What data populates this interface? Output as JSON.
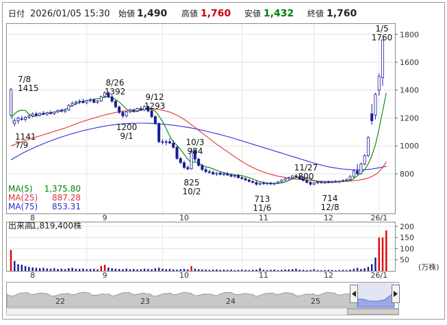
{
  "header": {
    "date_label": "日付",
    "datetime": "2026/01/05 15:30",
    "open_label": "始値",
    "open_value": "1,490",
    "high_label": "高値",
    "high_value": "1,760",
    "low_label": "安値",
    "low_value": "1,432",
    "close_label": "終値",
    "close_value": "1,760"
  },
  "legend": [
    {
      "name": "MA(5)",
      "value": "1,375.80",
      "color": "#008000"
    },
    {
      "name": "MA(25)",
      "value": "887.28",
      "color": "#e03030"
    },
    {
      "name": "MA(75)",
      "value": "853.31",
      "color": "#2b2bd8"
    }
  ],
  "volume_header": {
    "label": "出来高",
    "value": "1,819,400株"
  },
  "volume_unit": "(万株)",
  "colors": {
    "up": "#1a1a9a",
    "down": "#ffffff",
    "down_stroke": "#1a1a9a",
    "volume_bar": "#1a1a9a",
    "volume_highlight": "#e00000",
    "ma5": "#008000",
    "ma25": "#e03030",
    "ma75": "#2b2bd8",
    "high_value": "#cc0000",
    "low_value": "#008000"
  },
  "chart_data": {
    "type": "candlestick",
    "price_axis": {
      "ticks": [
        800,
        1000,
        1200,
        1400,
        1600,
        1800
      ],
      "range": [
        520,
        1870
      ]
    },
    "volume_axis": {
      "ticks": [
        50,
        100,
        150,
        200
      ],
      "range": [
        0,
        215
      ]
    },
    "x_tick_labels": [
      "8",
      "9",
      "10",
      "11",
      "12",
      "26/1"
    ],
    "navigator_labels": [
      "22",
      "23",
      "24",
      "25"
    ],
    "annotations": [
      {
        "date": "7/8",
        "value": "1415",
        "kind": "high"
      },
      {
        "date": "7/9",
        "value": "1141",
        "kind": "low"
      },
      {
        "date": "8/26",
        "value": "1392",
        "kind": "high"
      },
      {
        "date": "9/1",
        "value": "1200",
        "kind": "low"
      },
      {
        "date": "9/12",
        "value": "1293",
        "kind": "high"
      },
      {
        "date": "10/3",
        "value": "984",
        "kind": "high"
      },
      {
        "date": "10/2",
        "value": "825",
        "kind": "low"
      },
      {
        "date": "11/6",
        "value": "713",
        "kind": "low"
      },
      {
        "date": "11/27",
        "value": "800",
        "kind": "high"
      },
      {
        "date": "12/8",
        "value": "714",
        "kind": "low"
      },
      {
        "date": "1/5",
        "value": "1760",
        "kind": "high"
      }
    ],
    "candles": [
      {
        "o": 1220,
        "h": 1415,
        "l": 1210,
        "c": 1405
      },
      {
        "o": 1160,
        "h": 1200,
        "l": 1141,
        "c": 1180
      },
      {
        "o": 1180,
        "h": 1210,
        "l": 1160,
        "c": 1200
      },
      {
        "o": 1195,
        "h": 1215,
        "l": 1180,
        "c": 1190
      },
      {
        "o": 1190,
        "h": 1215,
        "l": 1175,
        "c": 1205
      },
      {
        "o": 1205,
        "h": 1225,
        "l": 1195,
        "c": 1215
      },
      {
        "o": 1215,
        "h": 1240,
        "l": 1205,
        "c": 1230
      },
      {
        "o": 1230,
        "h": 1245,
        "l": 1210,
        "c": 1220
      },
      {
        "o": 1220,
        "h": 1240,
        "l": 1210,
        "c": 1235
      },
      {
        "o": 1235,
        "h": 1250,
        "l": 1220,
        "c": 1228
      },
      {
        "o": 1228,
        "h": 1245,
        "l": 1215,
        "c": 1240
      },
      {
        "o": 1240,
        "h": 1255,
        "l": 1225,
        "c": 1232
      },
      {
        "o": 1232,
        "h": 1248,
        "l": 1222,
        "c": 1244
      },
      {
        "o": 1244,
        "h": 1262,
        "l": 1235,
        "c": 1255
      },
      {
        "o": 1255,
        "h": 1268,
        "l": 1240,
        "c": 1248
      },
      {
        "o": 1248,
        "h": 1262,
        "l": 1235,
        "c": 1258
      },
      {
        "o": 1258,
        "h": 1300,
        "l": 1250,
        "c": 1290
      },
      {
        "o": 1290,
        "h": 1320,
        "l": 1280,
        "c": 1305
      },
      {
        "o": 1305,
        "h": 1325,
        "l": 1290,
        "c": 1315
      },
      {
        "o": 1315,
        "h": 1335,
        "l": 1300,
        "c": 1320
      },
      {
        "o": 1320,
        "h": 1338,
        "l": 1305,
        "c": 1310
      },
      {
        "o": 1310,
        "h": 1330,
        "l": 1298,
        "c": 1325
      },
      {
        "o": 1325,
        "h": 1345,
        "l": 1312,
        "c": 1330
      },
      {
        "o": 1330,
        "h": 1342,
        "l": 1305,
        "c": 1312
      },
      {
        "o": 1312,
        "h": 1330,
        "l": 1300,
        "c": 1322
      },
      {
        "o": 1322,
        "h": 1360,
        "l": 1315,
        "c": 1355
      },
      {
        "o": 1355,
        "h": 1392,
        "l": 1345,
        "c": 1380
      },
      {
        "o": 1380,
        "h": 1390,
        "l": 1345,
        "c": 1352
      },
      {
        "o": 1352,
        "h": 1365,
        "l": 1310,
        "c": 1320
      },
      {
        "o": 1320,
        "h": 1330,
        "l": 1270,
        "c": 1280
      },
      {
        "o": 1280,
        "h": 1290,
        "l": 1230,
        "c": 1240
      },
      {
        "o": 1240,
        "h": 1255,
        "l": 1200,
        "c": 1215
      },
      {
        "o": 1215,
        "h": 1250,
        "l": 1205,
        "c": 1245
      },
      {
        "o": 1245,
        "h": 1270,
        "l": 1235,
        "c": 1255
      },
      {
        "o": 1255,
        "h": 1268,
        "l": 1240,
        "c": 1250
      },
      {
        "o": 1250,
        "h": 1275,
        "l": 1242,
        "c": 1268
      },
      {
        "o": 1268,
        "h": 1285,
        "l": 1252,
        "c": 1260
      },
      {
        "o": 1260,
        "h": 1293,
        "l": 1250,
        "c": 1282
      },
      {
        "o": 1282,
        "h": 1290,
        "l": 1240,
        "c": 1250
      },
      {
        "o": 1250,
        "h": 1262,
        "l": 1200,
        "c": 1210
      },
      {
        "o": 1210,
        "h": 1220,
        "l": 1150,
        "c": 1160
      },
      {
        "o": 1160,
        "h": 1170,
        "l": 1020,
        "c": 1030
      },
      {
        "o": 1030,
        "h": 1050,
        "l": 1010,
        "c": 1025
      },
      {
        "o": 1025,
        "h": 1045,
        "l": 1005,
        "c": 1030
      },
      {
        "o": 1030,
        "h": 1055,
        "l": 1015,
        "c": 1020
      },
      {
        "o": 1020,
        "h": 1040,
        "l": 980,
        "c": 990
      },
      {
        "o": 990,
        "h": 1000,
        "l": 900,
        "c": 910
      },
      {
        "o": 910,
        "h": 920,
        "l": 870,
        "c": 880
      },
      {
        "o": 880,
        "h": 895,
        "l": 835,
        "c": 845
      },
      {
        "o": 845,
        "h": 860,
        "l": 825,
        "c": 835
      },
      {
        "o": 835,
        "h": 984,
        "l": 830,
        "c": 965
      },
      {
        "o": 965,
        "h": 975,
        "l": 890,
        "c": 905
      },
      {
        "o": 905,
        "h": 915,
        "l": 850,
        "c": 860
      },
      {
        "o": 860,
        "h": 870,
        "l": 820,
        "c": 830
      },
      {
        "o": 830,
        "h": 845,
        "l": 805,
        "c": 815
      },
      {
        "o": 815,
        "h": 830,
        "l": 800,
        "c": 810
      },
      {
        "o": 810,
        "h": 822,
        "l": 792,
        "c": 798
      },
      {
        "o": 798,
        "h": 812,
        "l": 785,
        "c": 805
      },
      {
        "o": 805,
        "h": 815,
        "l": 790,
        "c": 795
      },
      {
        "o": 795,
        "h": 810,
        "l": 782,
        "c": 800
      },
      {
        "o": 800,
        "h": 812,
        "l": 786,
        "c": 790
      },
      {
        "o": 790,
        "h": 802,
        "l": 776,
        "c": 782
      },
      {
        "o": 782,
        "h": 795,
        "l": 770,
        "c": 788
      },
      {
        "o": 788,
        "h": 798,
        "l": 765,
        "c": 772
      },
      {
        "o": 772,
        "h": 785,
        "l": 758,
        "c": 765
      },
      {
        "o": 765,
        "h": 775,
        "l": 748,
        "c": 755
      },
      {
        "o": 755,
        "h": 765,
        "l": 738,
        "c": 745
      },
      {
        "o": 745,
        "h": 756,
        "l": 730,
        "c": 738
      },
      {
        "o": 738,
        "h": 748,
        "l": 713,
        "c": 725
      },
      {
        "o": 725,
        "h": 740,
        "l": 716,
        "c": 732
      },
      {
        "o": 732,
        "h": 745,
        "l": 722,
        "c": 728
      },
      {
        "o": 728,
        "h": 738,
        "l": 718,
        "c": 733
      },
      {
        "o": 733,
        "h": 742,
        "l": 722,
        "c": 726
      },
      {
        "o": 726,
        "h": 738,
        "l": 718,
        "c": 734
      },
      {
        "o": 734,
        "h": 748,
        "l": 726,
        "c": 742
      },
      {
        "o": 742,
        "h": 760,
        "l": 735,
        "c": 755
      },
      {
        "o": 755,
        "h": 772,
        "l": 748,
        "c": 765
      },
      {
        "o": 765,
        "h": 780,
        "l": 755,
        "c": 772
      },
      {
        "o": 772,
        "h": 790,
        "l": 765,
        "c": 785
      },
      {
        "o": 785,
        "h": 800,
        "l": 770,
        "c": 778
      },
      {
        "o": 778,
        "h": 790,
        "l": 760,
        "c": 765
      },
      {
        "o": 765,
        "h": 775,
        "l": 745,
        "c": 752
      },
      {
        "o": 752,
        "h": 762,
        "l": 730,
        "c": 738
      },
      {
        "o": 738,
        "h": 748,
        "l": 714,
        "c": 725
      },
      {
        "o": 725,
        "h": 740,
        "l": 718,
        "c": 735
      },
      {
        "o": 735,
        "h": 745,
        "l": 725,
        "c": 740
      },
      {
        "o": 740,
        "h": 750,
        "l": 730,
        "c": 735
      },
      {
        "o": 735,
        "h": 746,
        "l": 726,
        "c": 742
      },
      {
        "o": 742,
        "h": 752,
        "l": 732,
        "c": 738
      },
      {
        "o": 738,
        "h": 750,
        "l": 730,
        "c": 745
      },
      {
        "o": 745,
        "h": 756,
        "l": 736,
        "c": 741
      },
      {
        "o": 741,
        "h": 752,
        "l": 733,
        "c": 748
      },
      {
        "o": 748,
        "h": 760,
        "l": 740,
        "c": 752
      },
      {
        "o": 752,
        "h": 765,
        "l": 745,
        "c": 760
      },
      {
        "o": 760,
        "h": 790,
        "l": 752,
        "c": 780
      },
      {
        "o": 780,
        "h": 830,
        "l": 770,
        "c": 820
      },
      {
        "o": 820,
        "h": 870,
        "l": 790,
        "c": 800
      },
      {
        "o": 800,
        "h": 880,
        "l": 795,
        "c": 870
      },
      {
        "o": 870,
        "h": 940,
        "l": 860,
        "c": 930
      },
      {
        "o": 930,
        "h": 1070,
        "l": 920,
        "c": 1060
      },
      {
        "o": 1230,
        "h": 1300,
        "l": 1150,
        "c": 1180
      },
      {
        "o": 1220,
        "h": 1380,
        "l": 1190,
        "c": 1370
      },
      {
        "o": 1400,
        "h": 1520,
        "l": 1360,
        "c": 1500
      },
      {
        "o": 1490,
        "h": 1760,
        "l": 1432,
        "c": 1760
      }
    ],
    "ma5": [
      1200,
      1230,
      1250,
      1256,
      1254,
      1228,
      1212,
      1215,
      1222,
      1228,
      1232,
      1236,
      1240,
      1248,
      1255,
      1262,
      1275,
      1290,
      1302,
      1312,
      1320,
      1325,
      1330,
      1335,
      1338,
      1342,
      1350,
      1352,
      1345,
      1332,
      1315,
      1290,
      1265,
      1250,
      1245,
      1248,
      1255,
      1262,
      1265,
      1260,
      1250,
      1215,
      1175,
      1125,
      1070,
      1030,
      1005,
      975,
      940,
      905,
      880,
      885,
      875,
      860,
      850,
      845,
      835,
      825,
      815,
      808,
      802,
      797,
      792,
      790,
      786,
      780,
      772,
      763,
      752,
      744,
      738,
      733,
      730,
      729,
      731,
      735,
      742,
      752,
      762,
      772,
      778,
      778,
      772,
      762,
      750,
      742,
      738,
      736,
      737,
      739,
      740,
      742,
      745,
      748,
      752,
      765,
      785,
      805,
      830,
      870,
      930,
      1010,
      1120,
      1250,
      1380
    ],
    "ma25": [
      1000,
      1010,
      1020,
      1030,
      1040,
      1048,
      1056,
      1064,
      1072,
      1080,
      1088,
      1096,
      1104,
      1112,
      1120,
      1128,
      1138,
      1148,
      1158,
      1168,
      1176,
      1184,
      1192,
      1200,
      1208,
      1215,
      1222,
      1228,
      1234,
      1240,
      1244,
      1248,
      1252,
      1256,
      1258,
      1260,
      1262,
      1263,
      1264,
      1264,
      1263,
      1260,
      1256,
      1250,
      1242,
      1232,
      1220,
      1206,
      1190,
      1172,
      1152,
      1132,
      1112,
      1092,
      1072,
      1052,
      1032,
      1012,
      994,
      976,
      958,
      940,
      922,
      905,
      888,
      872,
      858,
      845,
      833,
      822,
      812,
      804,
      796,
      789,
      783,
      778,
      773,
      769,
      765,
      762,
      759,
      756,
      754,
      752,
      750,
      748,
      747,
      746,
      745,
      744,
      744,
      744,
      745,
      746,
      748,
      750,
      753,
      757,
      762,
      770,
      780,
      795,
      815,
      845,
      887.28
    ],
    "ma75": [
      900,
      915,
      930,
      945,
      958,
      970,
      982,
      994,
      1005,
      1016,
      1026,
      1036,
      1046,
      1055,
      1064,
      1072,
      1080,
      1088,
      1095,
      1102,
      1109,
      1115,
      1121,
      1127,
      1132,
      1137,
      1142,
      1146,
      1150,
      1153,
      1156,
      1158,
      1160,
      1161,
      1162,
      1163,
      1163,
      1163,
      1162,
      1161,
      1160,
      1158,
      1156,
      1154,
      1151,
      1148,
      1145,
      1141,
      1137,
      1133,
      1128,
      1123,
      1118,
      1112,
      1106,
      1100,
      1094,
      1088,
      1081,
      1074,
      1067,
      1060,
      1052,
      1044,
      1036,
      1028,
      1020,
      1012,
      1004,
      996,
      988,
      980,
      972,
      964,
      956,
      948,
      940,
      932,
      924,
      916,
      908,
      900,
      892,
      884,
      876,
      869,
      862,
      856,
      850,
      845,
      841,
      837,
      834,
      832,
      830,
      829,
      828,
      828,
      829,
      831,
      834,
      838,
      843,
      848,
      853.31
    ],
    "volume": [
      95,
      45,
      30,
      28,
      22,
      18,
      16,
      14,
      12,
      14,
      11,
      10,
      12,
      9,
      10,
      8,
      12,
      14,
      10,
      9,
      11,
      8,
      9,
      10,
      7,
      22,
      28,
      15,
      12,
      10,
      9,
      8,
      10,
      8,
      9,
      7,
      8,
      10,
      9,
      8,
      12,
      14,
      10,
      8,
      9,
      7,
      6,
      8,
      9,
      7,
      22,
      10,
      8,
      7,
      6,
      5,
      6,
      7,
      5,
      6,
      5,
      6,
      4,
      5,
      6,
      5,
      4,
      5,
      6,
      12,
      5,
      4,
      5,
      6,
      4,
      5,
      6,
      7,
      8,
      10,
      6,
      5,
      4,
      5,
      8,
      4,
      3,
      4,
      5,
      4,
      3,
      4,
      5,
      4,
      6,
      10,
      14,
      9,
      12,
      18,
      30,
      60,
      150,
      150,
      181.94
    ]
  }
}
